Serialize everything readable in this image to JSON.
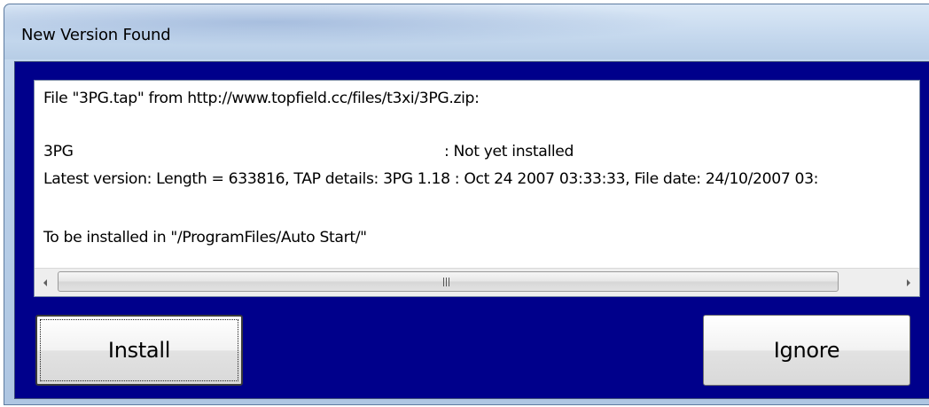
{
  "window": {
    "title": "New Version Found"
  },
  "info": {
    "line1": "File \"3PG.tap\" from http://www.topfield.cc/files/t3xi/3PG.zip:",
    "package_name": "3PG",
    "install_status": ": Not yet installed",
    "latest_version": "Latest version: Length = 633816, TAP details: 3PG 1.18 : Oct 24 2007 03:33:33, File date: 24/10/2007 03:",
    "install_path": "To be installed in \"/ProgramFiles/Auto Start/\"",
    "scrollbar_grip": "III"
  },
  "buttons": {
    "install_label": "Install",
    "ignore_label": "Ignore"
  },
  "colors": {
    "client_background": "#00008b",
    "info_background": "#ffffff"
  },
  "icons": {
    "scroll_left": "scroll-left-arrow-icon",
    "scroll_right": "scroll-right-arrow-icon",
    "grip": "scroll-grip-icon"
  }
}
